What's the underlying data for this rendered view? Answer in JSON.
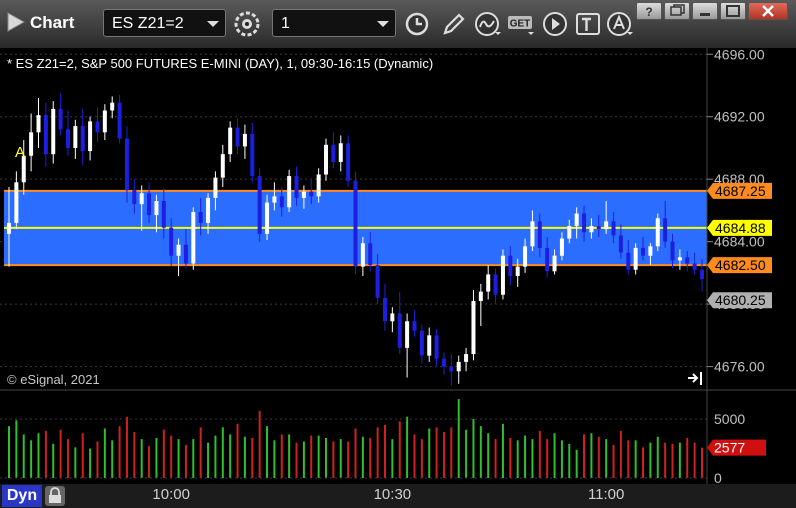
{
  "window": {
    "title": "Chart",
    "symbol": "ES Z21=2",
    "interval": "1",
    "window_buttons": [
      "?",
      "restore",
      "maximize",
      "close"
    ]
  },
  "toolbar_icons": [
    "settings-gear-icon",
    "clock-icon",
    "pencil-draw-icon",
    "study-wave-icon",
    "get-data-icon",
    "play-icon",
    "text-tool-icon",
    "alert-icon"
  ],
  "colors": {
    "background": "#000000",
    "up_bar": "#ffffff",
    "down_bar": "#1e1ee0",
    "band": "#2b6eff",
    "band_border": "#ff8a1e",
    "midline": "#ffff00",
    "last_price_tag": "#b0b0b0",
    "volume_up": "#2fbf2f",
    "volume_down": "#d02020",
    "volume_tag": "#d01010"
  },
  "chart_data": [
    {
      "type": "candlestick",
      "title": "* ES Z21=2, S&P 500 FUTURES E-MINI (DAY), 1, 09:30-16:15 (Dynamic)",
      "copyright": "© eSignal, 2021",
      "marker": "A",
      "ylim": [
        4674.5,
        4696.4
      ],
      "y_ticks": [
        "4696.00",
        "4692.00",
        "4688.00",
        "4684.00",
        "4680.00",
        "4676.00"
      ],
      "x_ticks": [
        "10:00",
        "10:30",
        "11:00"
      ],
      "band": {
        "upper": 4687.25,
        "middle": 4684.88,
        "lower": 4682.5
      },
      "price_tags": [
        {
          "label": "4687.25",
          "value": 4687.25,
          "style": "orange"
        },
        {
          "label": "4684.88",
          "value": 4684.88,
          "style": "yellow"
        },
        {
          "label": "4682.50",
          "value": 4682.5,
          "style": "orange"
        },
        {
          "label": "4680.25",
          "value": 4680.25,
          "style": "gray"
        }
      ],
      "bars": [
        [
          4684.5,
          4687.5,
          4682.4,
          4685.2
        ],
        [
          4685.2,
          4688.5,
          4684.8,
          4687.8
        ],
        [
          4687.8,
          4690.5,
          4687.0,
          4689.5
        ],
        [
          4689.5,
          4692.2,
          4688.5,
          4691.0
        ],
        [
          4691.0,
          4693.2,
          4690.0,
          4692.1
        ],
        [
          4692.1,
          4692.9,
          4688.8,
          4689.6
        ],
        [
          4689.6,
          4693.0,
          4689.0,
          4692.5
        ],
        [
          4692.5,
          4693.5,
          4690.8,
          4691.2
        ],
        [
          4691.2,
          4692.4,
          4689.5,
          4690.0
        ],
        [
          4690.0,
          4691.8,
          4689.3,
          4691.4
        ],
        [
          4691.4,
          4692.5,
          4688.9,
          4689.8
        ],
        [
          4689.8,
          4692.0,
          4689.2,
          4691.7
        ],
        [
          4691.7,
          4692.6,
          4690.4,
          4691.0
        ],
        [
          4691.0,
          4692.8,
          4690.5,
          4692.4
        ],
        [
          4692.4,
          4693.3,
          4691.9,
          4692.9
        ],
        [
          4692.9,
          4693.4,
          4690.3,
          4690.6
        ],
        [
          4690.6,
          4691.4,
          4686.5,
          4687.3
        ],
        [
          4687.3,
          4688.0,
          4685.8,
          4686.4
        ],
        [
          4686.4,
          4687.6,
          4684.7,
          4687.1
        ],
        [
          4687.1,
          4687.8,
          4685.2,
          4685.7
        ],
        [
          4685.7,
          4687.0,
          4684.6,
          4686.6
        ],
        [
          4686.6,
          4687.4,
          4684.2,
          4684.9
        ],
        [
          4684.9,
          4685.5,
          4682.4,
          4683.1
        ],
        [
          4683.1,
          4684.2,
          4681.8,
          4683.8
        ],
        [
          4683.8,
          4684.8,
          4682.3,
          4682.6
        ],
        [
          4682.6,
          4686.2,
          4682.2,
          4685.9
        ],
        [
          4685.9,
          4686.8,
          4684.4,
          4685.2
        ],
        [
          4685.2,
          4687.1,
          4684.5,
          4686.8
        ],
        [
          4686.8,
          4688.5,
          4686.0,
          4688.1
        ],
        [
          4688.1,
          4690.2,
          4687.5,
          4689.6
        ],
        [
          4689.6,
          4691.7,
          4689.1,
          4691.3
        ],
        [
          4691.3,
          4691.9,
          4689.6,
          4690.1
        ],
        [
          4690.1,
          4691.5,
          4689.3,
          4690.9
        ],
        [
          4690.9,
          4691.6,
          4687.8,
          4688.2
        ],
        [
          4688.2,
          4688.7,
          4684.0,
          4684.5
        ],
        [
          4684.5,
          4687.0,
          4684.1,
          4686.5
        ],
        [
          4686.5,
          4687.8,
          4686.0,
          4686.9
        ],
        [
          4686.9,
          4687.5,
          4685.6,
          4686.2
        ],
        [
          4686.2,
          4688.6,
          4685.9,
          4688.2
        ],
        [
          4688.2,
          4688.8,
          4686.3,
          4686.8
        ],
        [
          4686.8,
          4687.6,
          4686.1,
          4687.2
        ],
        [
          4687.2,
          4688.0,
          4686.4,
          4686.9
        ],
        [
          4686.9,
          4688.7,
          4686.5,
          4688.3
        ],
        [
          4688.3,
          4690.6,
          4687.9,
          4690.2
        ],
        [
          4690.2,
          4691.0,
          4688.7,
          4689.1
        ],
        [
          4689.1,
          4690.8,
          4688.5,
          4690.3
        ],
        [
          4690.3,
          4690.8,
          4687.5,
          4687.9
        ],
        [
          4687.9,
          4688.5,
          4681.9,
          4682.4
        ],
        [
          4682.4,
          4684.3,
          4681.8,
          4683.9
        ],
        [
          4683.9,
          4684.6,
          4682.1,
          4682.5
        ],
        [
          4682.5,
          4683.2,
          4680.0,
          4680.4
        ],
        [
          4680.4,
          4681.3,
          4678.3,
          4678.9
        ],
        [
          4678.9,
          4679.8,
          4678.2,
          4679.4
        ],
        [
          4679.4,
          4680.8,
          4676.8,
          4677.2
        ],
        [
          4677.2,
          4679.4,
          4675.3,
          4678.9
        ],
        [
          4678.9,
          4679.6,
          4677.9,
          4678.3
        ],
        [
          4678.3,
          4678.7,
          4676.2,
          4676.7
        ],
        [
          4676.7,
          4678.5,
          4676.3,
          4678.0
        ],
        [
          4678.0,
          4678.4,
          4676.0,
          4676.5
        ],
        [
          4676.5,
          4676.9,
          4675.5,
          4676.0
        ],
        [
          4676.0,
          4676.8,
          4674.8,
          4675.7
        ],
        [
          4675.7,
          4676.7,
          4674.9,
          4676.3
        ],
        [
          4676.3,
          4677.2,
          4675.7,
          4676.8
        ],
        [
          4676.8,
          4680.9,
          4676.4,
          4680.2
        ],
        [
          4680.2,
          4681.3,
          4678.6,
          4680.8
        ],
        [
          4680.8,
          4682.5,
          4680.3,
          4681.9
        ],
        [
          4681.9,
          4682.3,
          4680.0,
          4680.6
        ],
        [
          4680.6,
          4683.5,
          4680.3,
          4683.1
        ],
        [
          4683.1,
          4683.7,
          4681.2,
          4681.8
        ],
        [
          4681.8,
          4682.9,
          4681.1,
          4682.4
        ],
        [
          4682.4,
          4684.2,
          4682.0,
          4683.7
        ],
        [
          4683.7,
          4686.0,
          4683.4,
          4685.3
        ],
        [
          4685.3,
          4685.8,
          4683.0,
          4683.6
        ],
        [
          4683.6,
          4684.3,
          4681.7,
          4682.1
        ],
        [
          4682.1,
          4683.5,
          4681.9,
          4683.1
        ],
        [
          4683.1,
          4684.6,
          4682.8,
          4684.2
        ],
        [
          4684.2,
          4685.4,
          4683.9,
          4685.0
        ],
        [
          4685.0,
          4686.2,
          4684.2,
          4685.8
        ],
        [
          4685.8,
          4686.3,
          4684.0,
          4684.6
        ],
        [
          4684.6,
          4685.5,
          4684.2,
          4685.0
        ],
        [
          4685.0,
          4685.7,
          4684.3,
          4684.8
        ],
        [
          4684.8,
          4686.6,
          4684.5,
          4685.3
        ],
        [
          4685.3,
          4685.9,
          4683.9,
          4684.4
        ],
        [
          4684.4,
          4685.1,
          4682.9,
          4683.3
        ],
        [
          4683.3,
          4684.1,
          4681.9,
          4682.2
        ],
        [
          4682.2,
          4683.9,
          4681.9,
          4683.6
        ],
        [
          4683.6,
          4684.3,
          4682.8,
          4683.1
        ],
        [
          4683.1,
          4683.9,
          4682.5,
          4683.7
        ],
        [
          4683.7,
          4685.8,
          4683.4,
          4685.5
        ],
        [
          4685.5,
          4686.6,
          4683.6,
          4684.0
        ],
        [
          4684.0,
          4684.5,
          4682.3,
          4682.8
        ],
        [
          4682.8,
          4683.5,
          4682.2,
          4683.0
        ],
        [
          4683.0,
          4683.4,
          4682.1,
          4682.6
        ],
        [
          4682.6,
          4683.3,
          4681.9,
          4682.2
        ],
        [
          4682.2,
          4682.9,
          4680.8,
          4681.6
        ]
      ]
    },
    {
      "type": "bar",
      "subtype": "volume",
      "y_ticks": [
        "5000",
        "0"
      ],
      "ylim": [
        0,
        7300
      ],
      "last_value_label": "2577",
      "last_value": 2577,
      "series": [
        {
          "values": [
            4400,
            4900,
            3700,
            3200,
            3800,
            4000,
            2900,
            4100,
            3300,
            2600,
            3800,
            2500,
            3100,
            4200,
            3200,
            4400,
            5200,
            3900,
            3300,
            2700,
            3400,
            4100,
            3600,
            3300,
            2800,
            3300,
            4300,
            3000,
            3600,
            4300,
            3700,
            4600,
            3500,
            3400,
            5700,
            4400,
            3200,
            3700,
            3700,
            3000,
            3100,
            3600,
            3600,
            3400,
            3100,
            3300,
            3100,
            4200,
            3500,
            3400,
            4300,
            4500,
            3300,
            4800,
            5200,
            3700,
            3300,
            4200,
            4300,
            3900,
            4300,
            6700,
            4100,
            5000,
            4400,
            3800,
            3300,
            4600,
            3400,
            3200,
            3600,
            3300,
            4000,
            3300,
            3800,
            3200,
            2900,
            2400,
            3700,
            3800,
            3500,
            3300,
            2800,
            4000,
            3200,
            3200,
            2600,
            3000,
            3500,
            3000,
            2900,
            3000,
            3400,
            3000,
            2577
          ]
        }
      ]
    }
  ]
}
